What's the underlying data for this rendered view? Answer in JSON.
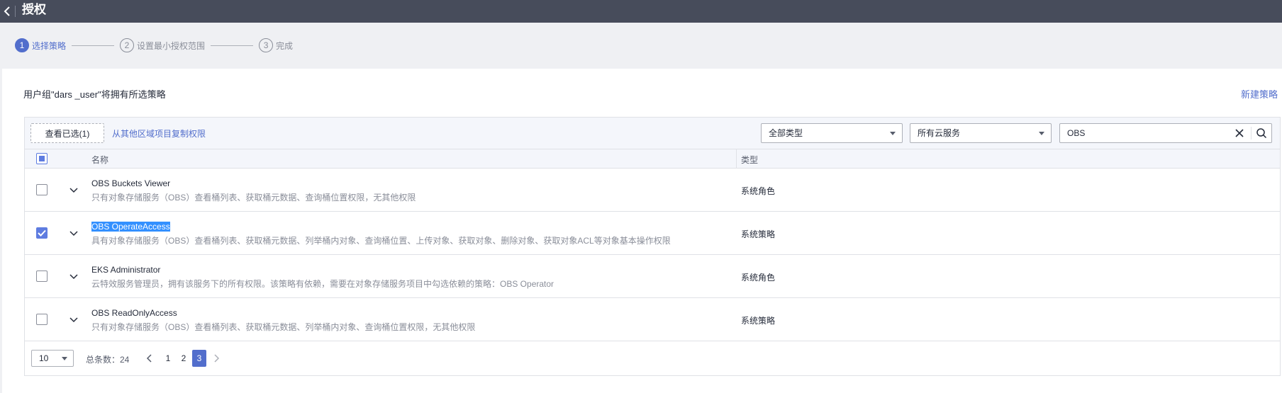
{
  "header": {
    "title": "授权",
    "back_icon": "chevron-left-icon"
  },
  "steps": [
    {
      "num": "1",
      "label": "选择策略",
      "active": true
    },
    {
      "num": "2",
      "label": "设置最小授权范围",
      "active": false
    },
    {
      "num": "3",
      "label": "完成",
      "active": false
    }
  ],
  "group_desc": "用户组\"dars _user\"将拥有所选策略",
  "new_policy_label": "新建策略",
  "toolbar": {
    "view_selected_label": "查看已选(1)",
    "copy_link_label": "从其他区域项目复制权限",
    "type_select": "全部类型",
    "service_select": "所有云服务",
    "search_value": "OBS"
  },
  "table": {
    "headers": {
      "name": "名称",
      "type": "类型"
    },
    "rows": [
      {
        "name": "OBS Buckets Viewer",
        "desc": "只有对象存储服务（OBS）查看桶列表、获取桶元数据、查询桶位置权限，无其他权限",
        "type": "系统角色",
        "checked": false,
        "highlight": false
      },
      {
        "name": "OBS OperateAccess",
        "desc": "具有对象存储服务（OBS）查看桶列表、获取桶元数据、列举桶内对象、查询桶位置、上传对象、获取对象、删除对象、获取对象ACL等对象基本操作权限",
        "type": "系统策略",
        "checked": true,
        "highlight": true
      },
      {
        "name": "EKS Administrator",
        "desc": "云特效服务管理员，拥有该服务下的所有权限。该策略有依赖，需要在对象存储服务项目中勾选依赖的策略：OBS Operator",
        "type": "系统角色",
        "checked": false,
        "highlight": false
      },
      {
        "name": "OBS ReadOnlyAccess",
        "desc": "只有对象存储服务（OBS）查看桶列表、获取桶元数据、列举桶内对象、查询桶位置权限，无其他权限",
        "type": "系统策略",
        "checked": false,
        "highlight": false
      }
    ]
  },
  "pagination": {
    "page_size": "10",
    "total_label": "总条数：24",
    "pages": [
      "1",
      "2",
      "3"
    ],
    "current": "3"
  },
  "colors": {
    "accent": "#526ecc",
    "topbar": "#474c5b",
    "checkbox": "#5e7ce0",
    "highlight": "#3390ff"
  }
}
